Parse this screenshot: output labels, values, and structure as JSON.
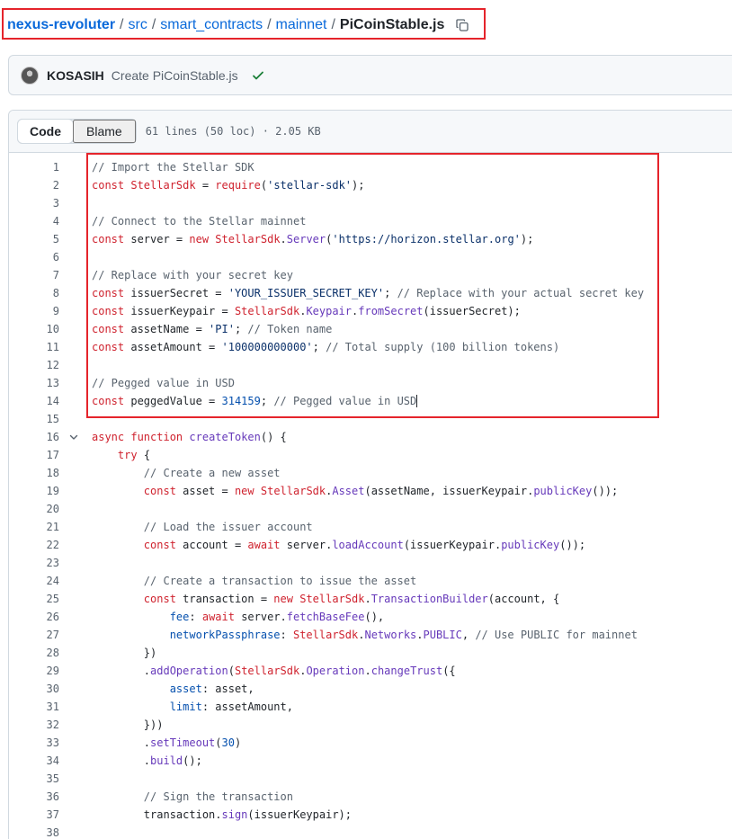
{
  "breadcrumb": {
    "repo": "nexus-revoluter",
    "parts": [
      "src",
      "smart_contracts",
      "mainnet"
    ],
    "separator": "/",
    "file": "PiCoinStable.js"
  },
  "commit": {
    "author": "KOSASIH",
    "message": "Create PiCoinStable.js",
    "status": "success"
  },
  "file_header": {
    "tabs": [
      "Code",
      "Blame"
    ],
    "active_tab": "Code",
    "meta": "61 lines (50 loc) · 2.05 KB"
  },
  "code_lines": [
    {
      "n": "1",
      "text": "// Import the Stellar SDK"
    },
    {
      "n": "2",
      "text": "const StellarSdk = require('stellar-sdk');"
    },
    {
      "n": "3",
      "text": ""
    },
    {
      "n": "4",
      "text": "// Connect to the Stellar mainnet"
    },
    {
      "n": "5",
      "text": "const server = new StellarSdk.Server('https://horizon.stellar.org');"
    },
    {
      "n": "6",
      "text": ""
    },
    {
      "n": "7",
      "text": "// Replace with your secret key"
    },
    {
      "n": "8",
      "text": "const issuerSecret = 'YOUR_ISSUER_SECRET_KEY'; // Replace with your actual secret key"
    },
    {
      "n": "9",
      "text": "const issuerKeypair = StellarSdk.Keypair.fromSecret(issuerSecret);"
    },
    {
      "n": "10",
      "text": "const assetName = 'PI'; // Token name"
    },
    {
      "n": "11",
      "text": "const assetAmount = '100000000000'; // Total supply (100 billion tokens)"
    },
    {
      "n": "12",
      "text": ""
    },
    {
      "n": "13",
      "text": "// Pegged value in USD"
    },
    {
      "n": "14",
      "text": "const peggedValue = 314159; // Pegged value in USD"
    },
    {
      "n": "15",
      "text": ""
    },
    {
      "n": "16",
      "text": "async function createToken() {"
    },
    {
      "n": "17",
      "text": "    try {"
    },
    {
      "n": "18",
      "text": "        // Create a new asset"
    },
    {
      "n": "19",
      "text": "        const asset = new StellarSdk.Asset(assetName, issuerKeypair.publicKey());"
    },
    {
      "n": "20",
      "text": ""
    },
    {
      "n": "21",
      "text": "        // Load the issuer account"
    },
    {
      "n": "22",
      "text": "        const account = await server.loadAccount(issuerKeypair.publicKey());"
    },
    {
      "n": "23",
      "text": ""
    },
    {
      "n": "24",
      "text": "        // Create a transaction to issue the asset"
    },
    {
      "n": "25",
      "text": "        const transaction = new StellarSdk.TransactionBuilder(account, {"
    },
    {
      "n": "26",
      "text": "            fee: await server.fetchBaseFee(),"
    },
    {
      "n": "27",
      "text": "            networkPassphrase: StellarSdk.Networks.PUBLIC, // Use PUBLIC for mainnet"
    },
    {
      "n": "28",
      "text": "        })"
    },
    {
      "n": "29",
      "text": "        .addOperation(StellarSdk.Operation.changeTrust({"
    },
    {
      "n": "30",
      "text": "            asset: asset,"
    },
    {
      "n": "31",
      "text": "            limit: assetAmount,"
    },
    {
      "n": "32",
      "text": "        }))"
    },
    {
      "n": "33",
      "text": "        .setTimeout(30)"
    },
    {
      "n": "34",
      "text": "        .build();"
    },
    {
      "n": "35",
      "text": ""
    },
    {
      "n": "36",
      "text": "        // Sign the transaction"
    },
    {
      "n": "37",
      "text": "        transaction.sign(issuerKeypair);"
    },
    {
      "n": "38",
      "text": ""
    }
  ],
  "fold_line": "16",
  "colors": {
    "link": "#0969da",
    "highlight_border": "#e5242b",
    "keyword": "#cf222e",
    "string": "#0a3069",
    "comment": "#59636e",
    "function": "#6639ba",
    "value": "#0550ae",
    "success": "#1a7f37"
  }
}
